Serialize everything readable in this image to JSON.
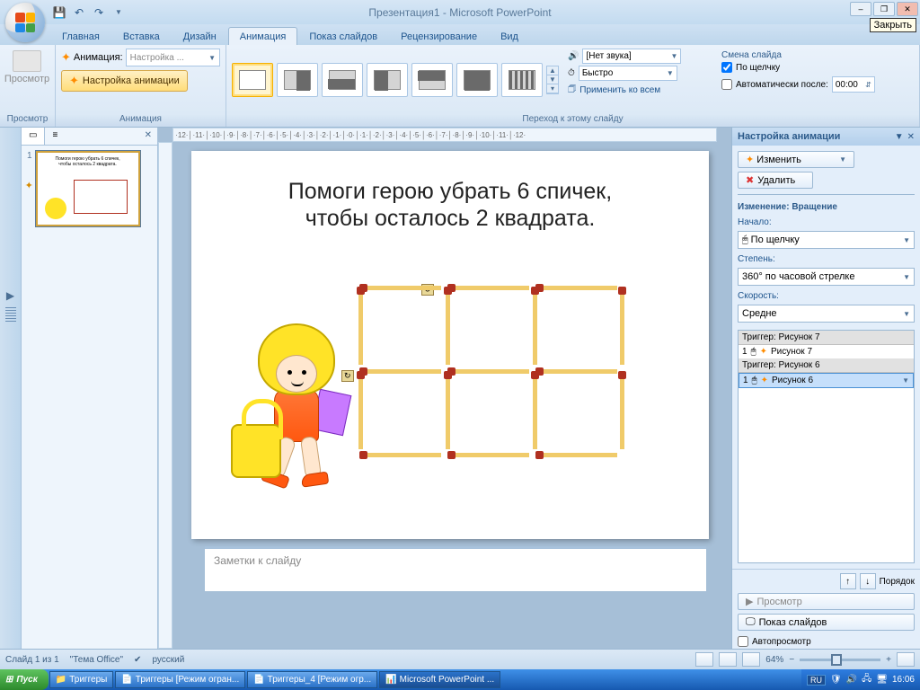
{
  "title": "Презентация1 - Microsoft PowerPoint",
  "close_tooltip": "Закрыть",
  "tabs": [
    "Главная",
    "Вставка",
    "Дизайн",
    "Анимация",
    "Показ слайдов",
    "Рецензирование",
    "Вид"
  ],
  "active_tab": "Анимация",
  "ribbon": {
    "preview_label": "Просмотр",
    "preview_group": "Просмотр",
    "anim_label": "Анимация:",
    "anim_combo": "Настройка ...",
    "anim_settings_btn": "Настройка анимации",
    "anim_group": "Анимация",
    "sound_label": "[Нет звука]",
    "speed_label": "Быстро",
    "apply_all": "Применить ко всем",
    "trans_group": "Переход к этому слайду",
    "change_title": "Смена слайда",
    "on_click": "По щелчку",
    "auto_after": "Автоматически после:",
    "auto_time": "00:00"
  },
  "slidepanel": {
    "tab_slides_icon": "▭",
    "tab_outline_icon": "≡"
  },
  "slide": {
    "line1": "Помоги герою убрать 6 спичек,",
    "line2": "чтобы осталось 2 квадрата."
  },
  "notes_placeholder": "Заметки к слайду",
  "taskpane": {
    "title": "Настройка анимации",
    "change_btn": "Изменить",
    "remove_btn": "Удалить",
    "modification": "Изменение: Вращение",
    "start_label": "Начало:",
    "start_value": "По щелчку",
    "amount_label": "Степень:",
    "amount_value": "360° по часовой стрелке",
    "speed_label": "Скорость:",
    "speed_value": "Средне",
    "trigger1_head": "Триггер: Рисунок 7",
    "trigger1_item": "Рисунок 7",
    "trigger2_head": "Триггер: Рисунок 6",
    "trigger2_item": "Рисунок 6",
    "reorder": "Порядок",
    "play": "Просмотр",
    "slideshow": "Показ слайдов",
    "autopreview": "Автопросмотр"
  },
  "statusbar": {
    "slide_info": "Слайд 1 из 1",
    "theme": "\"Тема Office\"",
    "lang": "русский",
    "zoom": "64%"
  },
  "taskbar": {
    "start": "Пуск",
    "items": [
      "Триггеры",
      "Триггеры [Режим огран...",
      "Триггеры_4 [Режим огр...",
      "Microsoft PowerPoint ..."
    ],
    "lang": "RU",
    "time": "16:06"
  }
}
